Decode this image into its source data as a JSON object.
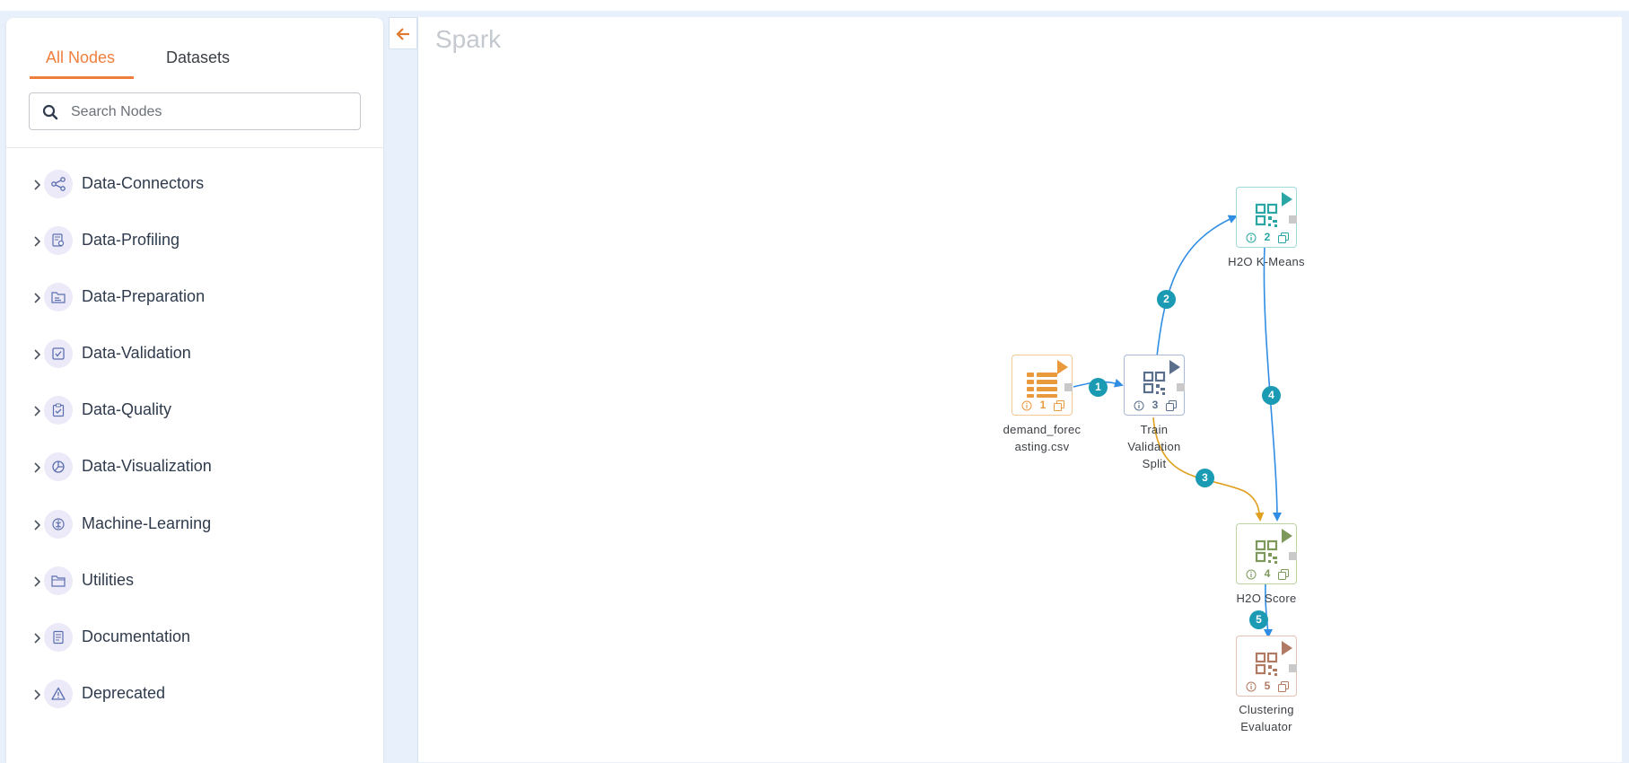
{
  "sidebar": {
    "tabs": [
      {
        "label": "All Nodes",
        "active": true
      },
      {
        "label": "Datasets",
        "active": false
      }
    ],
    "search": {
      "placeholder": "Search Nodes",
      "value": ""
    },
    "categories": [
      {
        "label": "Data-Connectors",
        "icon": "share-icon"
      },
      {
        "label": "Data-Profiling",
        "icon": "document-search-icon"
      },
      {
        "label": "Data-Preparation",
        "icon": "folder-chart-icon"
      },
      {
        "label": "Data-Validation",
        "icon": "checkbox-icon"
      },
      {
        "label": "Data-Quality",
        "icon": "clipboard-check-icon"
      },
      {
        "label": "Data-Visualization",
        "icon": "pie-chart-icon"
      },
      {
        "label": "Machine-Learning",
        "icon": "brain-icon"
      },
      {
        "label": "Utilities",
        "icon": "folder-icon"
      },
      {
        "label": "Documentation",
        "icon": "document-icon"
      },
      {
        "label": "Deprecated",
        "icon": "warning-icon"
      }
    ]
  },
  "canvas": {
    "title": "Spark",
    "nodes": [
      {
        "id": "1",
        "label": "demand_forecasting.csv",
        "label_lines": [
          "demand_forec",
          "asting.csv"
        ],
        "color": "#e89a3c",
        "icon": "table-icon"
      },
      {
        "id": "3",
        "label": "Train Validation Split",
        "label_lines": [
          "Train",
          "Validation",
          "Split"
        ],
        "color": "#5a6f8c",
        "icon": "qr-icon"
      },
      {
        "id": "2",
        "label": "H2O K-Means",
        "label_lines": [
          "H2O K-Means"
        ],
        "color": "#2aa7a4",
        "icon": "qr-icon"
      },
      {
        "id": "4",
        "label": "H2O Score",
        "label_lines": [
          "H2O Score"
        ],
        "color": "#7d9a5c",
        "icon": "qr-icon"
      },
      {
        "id": "5",
        "label": "Clustering Evaluator",
        "label_lines": [
          "Clustering",
          "Evaluator"
        ],
        "color": "#b07a63",
        "icon": "qr-icon"
      }
    ],
    "edges": [
      {
        "badge": "1",
        "from": "1",
        "to": "3",
        "color": "#2f8de4"
      },
      {
        "badge": "2",
        "from": "3",
        "to": "2",
        "color": "#2f8de4"
      },
      {
        "badge": "3",
        "from": "3",
        "to": "4",
        "color": "#e0a020"
      },
      {
        "badge": "4",
        "from": "2",
        "to": "4",
        "color": "#2f8de4"
      },
      {
        "badge": "5",
        "from": "4",
        "to": "5",
        "color": "#2f8de4"
      }
    ]
  }
}
